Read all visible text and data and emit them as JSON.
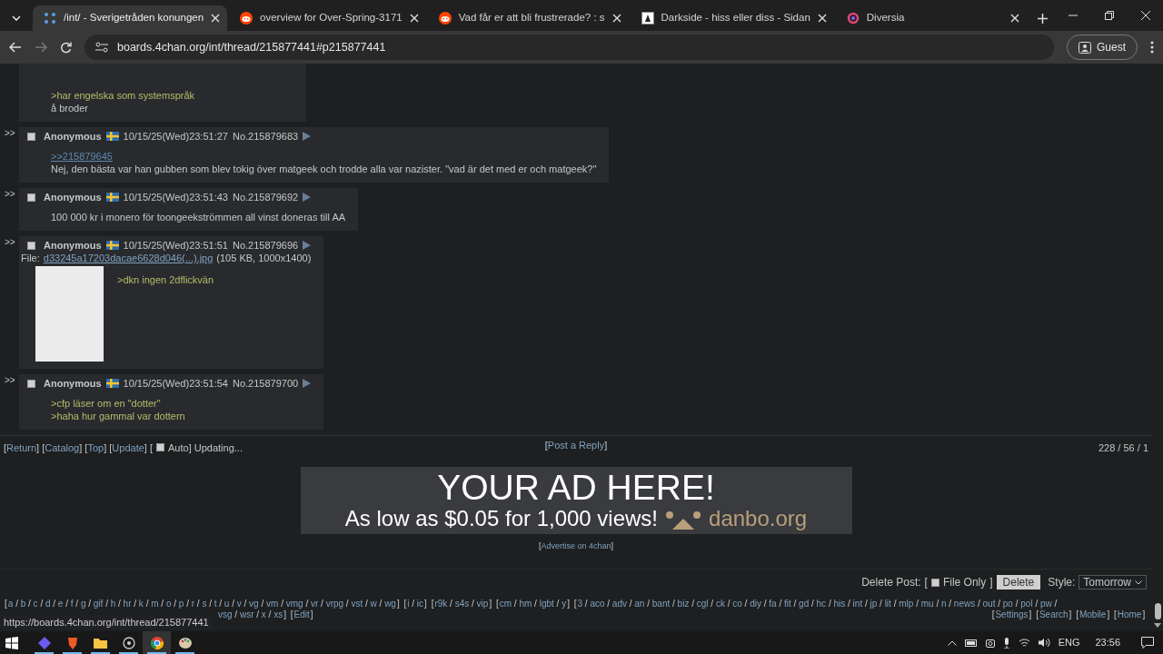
{
  "browser": {
    "tabs": [
      {
        "title": "/int/ - Sverigetråden konungen",
        "selected": true
      },
      {
        "title": "overview for Over-Spring-3171",
        "selected": false
      },
      {
        "title": "Vad får er att bli frustrerade? : s",
        "selected": false
      },
      {
        "title": "Darkside - hiss eller diss - Sidan",
        "selected": false
      },
      {
        "title": "Diversia",
        "selected": false
      }
    ],
    "url": "boards.4chan.org/int/thread/215877441#p215877441",
    "profile": "Guest"
  },
  "thread": {
    "posts": [
      {
        "kind": "continued",
        "lines": [
          {
            "kind": "green",
            "text": ">har engelska som systemspråk"
          },
          {
            "kind": "plain",
            "text": "å broder"
          }
        ]
      },
      {
        "kind": "reply",
        "side": ">>",
        "checked": false,
        "name": "Anonymous",
        "datetime": "10/15/25(Wed)23:51:27",
        "number": "No.215879683",
        "lines": [
          {
            "kind": "quotelink",
            "text": ">>215879645"
          },
          {
            "kind": "plain",
            "text": "Nej, den bästa var han gubben som blev tokig över matgeek och trodde alla var nazister. \"vad är det med er och matgeek?\""
          }
        ]
      },
      {
        "kind": "reply",
        "side": ">>",
        "checked": false,
        "name": "Anonymous",
        "datetime": "10/15/25(Wed)23:51:43",
        "number": "No.215879692",
        "lines": [
          {
            "kind": "plain",
            "text": "100 000 kr i monero för toongeekströmmen all vinst doneras till AA"
          }
        ]
      },
      {
        "kind": "reply",
        "side": ">>",
        "checked": false,
        "name": "Anonymous",
        "datetime": "10/15/25(Wed)23:51:51",
        "number": "No.215879696",
        "file": {
          "label": "File:",
          "name": "d33245a17203dacae6628d046(...).jpg",
          "info": "(105 KB, 1000x1400)"
        },
        "lines": [
          {
            "kind": "green",
            "text": ">dkn ingen 2dflickvän"
          }
        ]
      },
      {
        "kind": "reply",
        "side": ">>",
        "checked": false,
        "name": "Anonymous",
        "datetime": "10/15/25(Wed)23:51:54",
        "number": "No.215879700",
        "lines": [
          {
            "kind": "green",
            "text": ">cfp läser om en \"dotter\""
          },
          {
            "kind": "green",
            "text": ">haha hur gammal var dottern"
          }
        ]
      }
    ]
  },
  "brackets": {
    "open": "[",
    "close": "]",
    "separator": "/"
  },
  "nav": {
    "links": [
      "Return",
      "Catalog",
      "Top",
      "Update"
    ],
    "auto": {
      "label": "Auto",
      "checked": false
    },
    "status": "Updating...",
    "post_reply": "Post a Reply",
    "stats": "228 / 56 / 1"
  },
  "ad": {
    "headline": "YOUR AD HERE!",
    "subline": "As low as $0.05 for 1,000 views!",
    "brand": "danbo.org",
    "advertise": "Advertise on 4chan"
  },
  "delete": {
    "label": "Delete Post:",
    "file_only": {
      "label": "File Only",
      "checked": false
    },
    "button": "Delete",
    "style_label": "Style:",
    "style_value": "Tomorrow"
  },
  "boards": {
    "line_1": [
      {
        "open": "[",
        "close": "]",
        "boards": [
          "a",
          "b",
          "c",
          "d",
          "e",
          "f",
          "g",
          "gif",
          "h",
          "hr",
          "k",
          "m",
          "o",
          "p",
          "r",
          "s",
          "t",
          "u",
          "v",
          "vg",
          "vm",
          "vmg",
          "vr",
          "vrpg",
          "vst",
          "w",
          "wg"
        ]
      },
      {
        "open": "[",
        "close": "]",
        "boards": [
          "i",
          "ic"
        ]
      },
      {
        "open": "[",
        "close": "]",
        "boards": [
          "r9k",
          "s4s",
          "vip"
        ]
      },
      {
        "open": "[",
        "close": "]",
        "boards": [
          "cm",
          "hm",
          "lgbt",
          "y"
        ]
      },
      {
        "open": "[",
        "close": "/",
        "boards": [
          "3",
          "aco",
          "adv",
          "an",
          "bant",
          "biz",
          "cgl",
          "ck",
          "co",
          "diy",
          "fa",
          "fit",
          "gd",
          "hc",
          "his",
          "int",
          "jp",
          "lit",
          "mlp",
          "mu",
          "n",
          "news",
          "out",
          "po",
          "pol",
          "pw"
        ]
      }
    ],
    "line_2": [
      {
        "close": "]",
        "boards": [
          "vsg",
          "wsr",
          "x",
          "xs"
        ]
      },
      {
        "open": "[",
        "close": "]",
        "boards": [
          "Edit"
        ]
      }
    ],
    "right": [
      {
        "open": "[",
        "close": "]",
        "boards": [
          "Settings"
        ]
      },
      {
        "open": "[",
        "close": "]",
        "boards": [
          "Search"
        ]
      },
      {
        "open": "[",
        "close": "]",
        "boards": [
          "Mobile"
        ]
      },
      {
        "open": "[",
        "close": "]",
        "boards": [
          "Home"
        ]
      }
    ]
  },
  "status_url": "https://boards.4chan.org/int/thread/215877441",
  "taskbar": {
    "apps": [
      {
        "running": true,
        "selected": false
      },
      {
        "running": true,
        "selected": false
      },
      {
        "running": true,
        "selected": false
      },
      {
        "running": true,
        "selected": false
      },
      {
        "running": true,
        "selected": true
      },
      {
        "running": true,
        "selected": false
      }
    ],
    "language": "ENG",
    "time": "23:56"
  }
}
